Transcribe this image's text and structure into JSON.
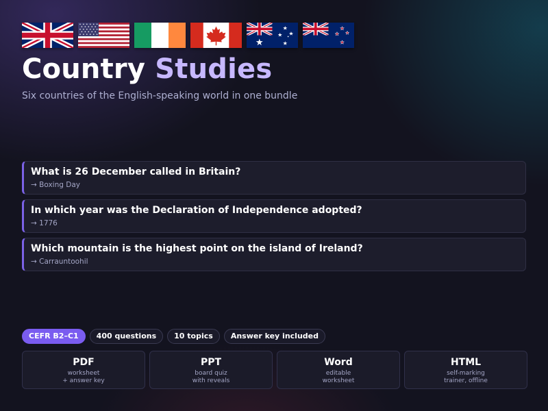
{
  "flags": [
    {
      "icon": "uk-flag-icon"
    },
    {
      "icon": "us-flag-icon"
    },
    {
      "icon": "ireland-flag-icon"
    },
    {
      "icon": "canada-flag-icon"
    },
    {
      "icon": "australia-flag-icon"
    },
    {
      "icon": "new-zealand-flag-icon"
    }
  ],
  "header": {
    "title_word1": "Country",
    "title_word2": "Studies",
    "subtitle": "Six countries of the English-speaking world in one bundle"
  },
  "questions": [
    {
      "question": "What is 26 December called in Britain?",
      "answer": "→ Boxing Day"
    },
    {
      "question": "In which year was the Declaration of Independence adopted?",
      "answer": "→ 1776"
    },
    {
      "question": "Which mountain is the highest point on the island of Ireland?",
      "answer": "→ Carrauntoohil"
    }
  ],
  "badges": [
    "CEFR B2–C1",
    "400 questions",
    "10 topics",
    "Answer key included"
  ],
  "formats": [
    {
      "name": "PDF",
      "line1": "worksheet",
      "line2": "+ answer key"
    },
    {
      "name": "PPT",
      "line1": "board quiz",
      "line2": "with reveals"
    },
    {
      "name": "Word",
      "line1": "editable",
      "line2": "worksheet"
    },
    {
      "name": "HTML",
      "line1": "self-marking",
      "line2": "trainer, offline"
    }
  ],
  "colors": {
    "background": "#13131f",
    "accent": "#7a5cf0",
    "title_highlight": "#c7b8ff",
    "card": "#1d1d2c"
  }
}
